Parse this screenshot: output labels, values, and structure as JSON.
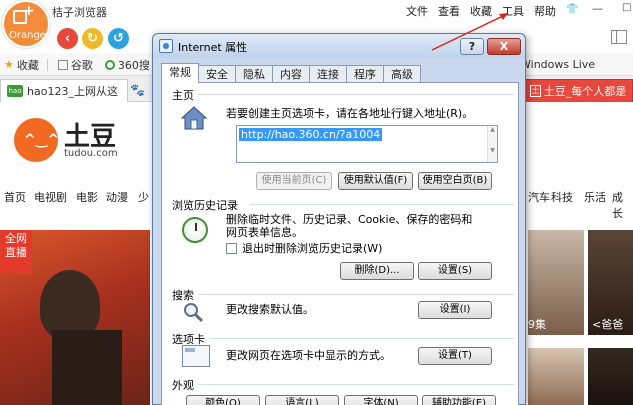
{
  "browser": {
    "logo_text": "Orange",
    "app_title": "桔子浏览器",
    "menu": [
      "文件",
      "查看",
      "收藏",
      "工具",
      "帮助"
    ],
    "win_min": "—",
    "win_max": "□",
    "win_close": "✕",
    "accent_color": "#f48b3a"
  },
  "favorites": {
    "items": [
      "收藏",
      "谷歌",
      "360搜"
    ],
    "right_label": "Windows Live"
  },
  "tabs": {
    "left_label": "hao123_上网从这",
    "left_icon_text": "hao",
    "right_label": "土豆_每个人都是生",
    "right_icon_text": "土"
  },
  "page": {
    "site_name": "土豆",
    "site_domain": "tudou.com",
    "categories": [
      "首页",
      "电视剧",
      "电影",
      "动漫",
      "少",
      "汽车",
      "科技",
      "乐活",
      "成长"
    ],
    "banner_tag": "全网直播",
    "captions": [
      "9集",
      "<爸爸去"
    ]
  },
  "dialog": {
    "title": "Internet 属性",
    "help_label": "?",
    "close_label": "X",
    "tabs": [
      "常规",
      "安全",
      "隐私",
      "内容",
      "连接",
      "程序",
      "高级"
    ],
    "home": {
      "label": "主页",
      "desc": "若要创建主页选项卡，请在各地址行键入地址(R)。",
      "url": "http://hao.360.cn/?a1004",
      "btn_current": "使用当前页(C)",
      "btn_default": "使用默认值(F)",
      "btn_blank": "使用空白页(B)"
    },
    "history": {
      "label": "浏览历史记录",
      "desc": "删除临时文件、历史记录、Cookie、保存的密码和网页表单信息。",
      "checkbox": "退出时删除浏览历史记录(W)",
      "btn_delete": "删除(D)...",
      "btn_settings": "设置(S)"
    },
    "search": {
      "label": "搜索",
      "desc": "更改搜索默认值。",
      "btn_settings": "设置(I)"
    },
    "tabs_section": {
      "label": "选项卡",
      "desc": "更改网页在选项卡中显示的方式。",
      "btn_settings": "设置(T)"
    },
    "appearance": {
      "label": "外观",
      "buttons": [
        "颜色(O)",
        "语言(L)",
        "字体(N)",
        "辅助功能(E)"
      ]
    }
  }
}
